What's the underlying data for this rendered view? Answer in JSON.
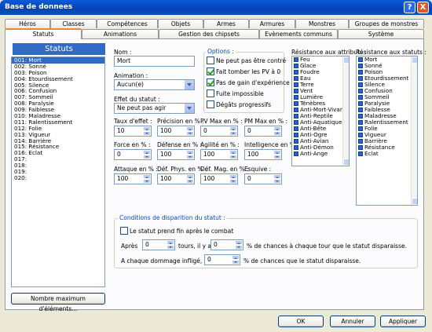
{
  "window": {
    "title": "Base de donnees",
    "help": "?",
    "close": "X"
  },
  "tabs_row1": [
    "Héros",
    "Classes",
    "Compétences",
    "Objets",
    "Armes",
    "Armures",
    "Monstres",
    "Groupes de monstres"
  ],
  "tabs_row2": [
    "Statuts",
    "Animations",
    "Gestion des chipsets",
    "Evènements communs",
    "Système"
  ],
  "left": {
    "header": "Statuts",
    "items": [
      "001: Mort",
      "002: Sonné",
      "003: Poison",
      "004: Etourdissement",
      "005: Silence",
      "006: Confusion",
      "007: Sommeil",
      "008: Paralysie",
      "009: Faiblesse",
      "010: Maladresse",
      "011: Ralentissement",
      "012: Folie",
      "013: Vigueur",
      "014: Barrière",
      "015: Résistance",
      "016: Eclat",
      "017:",
      "018:",
      "019:",
      "020:"
    ],
    "max_button": "Nombre maximum d'éléments..."
  },
  "form": {
    "name_label": "Nom :",
    "name_value": "Mort",
    "animation_label": "Animation :",
    "animation_value": "Aucun(e)",
    "effect_label": "Effet du statut :",
    "effect_value": "Ne peut pas agir",
    "options_label": "Options :",
    "options": [
      {
        "label": "Ne peut pas être contré",
        "checked": false
      },
      {
        "label": "Fait tomber les PV à 0",
        "checked": true
      },
      {
        "label": "Pas de gain d'expérience",
        "checked": true
      },
      {
        "label": "Fuite impossible",
        "checked": false
      },
      {
        "label": "Dégâts progressifs",
        "checked": false
      }
    ],
    "stats": [
      {
        "label": "Taux d'effet :",
        "value": "10"
      },
      {
        "label": "Précision en % :",
        "value": "100"
      },
      {
        "label": "PV Max en % :",
        "value": "0"
      },
      {
        "label": "PM Max en % :",
        "value": "0"
      },
      {
        "label": "Force en % :",
        "value": "0"
      },
      {
        "label": "Défense en % :",
        "value": "100"
      },
      {
        "label": "Agilité en % :",
        "value": "100"
      },
      {
        "label": "Intelligence en % :",
        "value": "100"
      },
      {
        "label": "Attaque en % :",
        "value": "100"
      },
      {
        "label": "Déf. Phys. en % :",
        "value": "100"
      },
      {
        "label": "Déf. Mag. en % :",
        "value": "100"
      },
      {
        "label": "Esquive :",
        "value": "0"
      }
    ],
    "attr_label": "Résistance aux attributs :",
    "attributes": [
      "Feu",
      "Glace",
      "Foudre",
      "Eau",
      "Terre",
      "Vent",
      "Lumière",
      "Ténèbres",
      "Anti-Mort-Vivant",
      "Anti-Reptile",
      "Anti-Aquatique",
      "Anti-Bête",
      "Anti-Ogre",
      "Anti-Avian",
      "Anti-Démon",
      "Anti-Ange"
    ],
    "status_res_label": "Résistance aux statuts :",
    "status_res": [
      "Mort",
      "Sonné",
      "Poison",
      "Etourdissement",
      "Silence",
      "Confusion",
      "Sommeil",
      "Paralysie",
      "Faiblesse",
      "Maladresse",
      "Ralentissement",
      "Folie",
      "Vigueur",
      "Barrière",
      "Résistance",
      "Eclat"
    ],
    "cond": {
      "title": "Conditions de disparition du statut :",
      "end_fight": "Le statut prend fin après le combat",
      "after": "Après",
      "turns_value": "0",
      "turns_text": "tours, il y a",
      "chance1_value": "0",
      "chance1_text": "% de chances à chaque tour que le statut disparaisse.",
      "dmg_text": "A chaque dommage infligé, il y a",
      "chance2_value": "0",
      "chance2_text": "% de chances que le statut disparaisse."
    }
  },
  "buttons": {
    "ok": "OK",
    "cancel": "Annuler",
    "apply": "Appliquer"
  }
}
